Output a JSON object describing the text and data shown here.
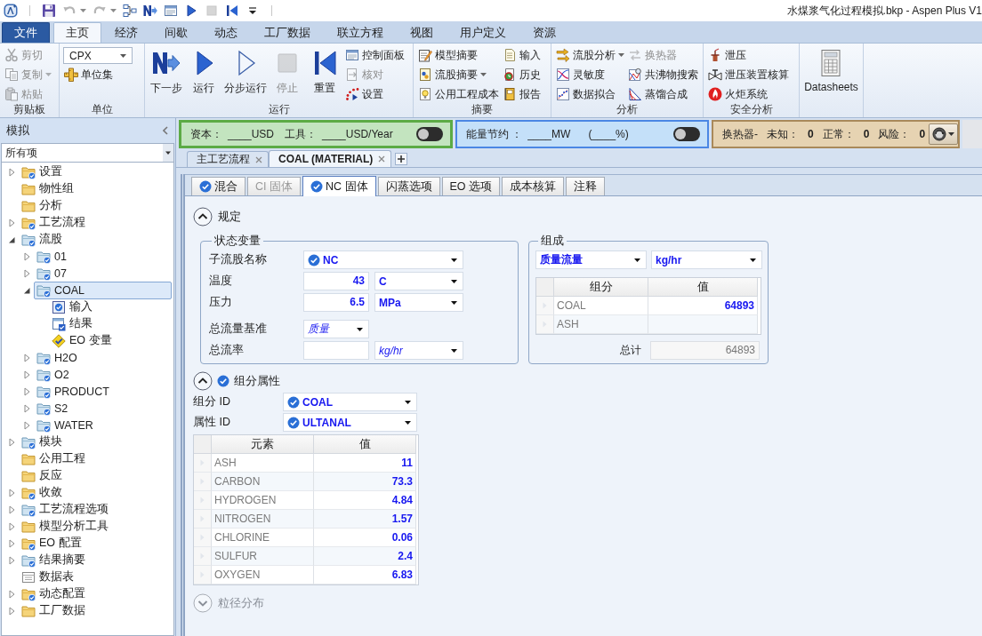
{
  "quick_access": {
    "buttons": [
      {
        "kind": "logo",
        "disabled": false
      },
      {
        "kind": "save",
        "disabled": false
      },
      {
        "kind": "undo",
        "disabled": true,
        "menu": true
      },
      {
        "kind": "redo",
        "disabled": true,
        "menu": true
      },
      {
        "kind": "flowsheet",
        "disabled": false
      },
      {
        "kind": "next",
        "disabled": false
      },
      {
        "kind": "panel",
        "disabled": false
      },
      {
        "kind": "run",
        "disabled": false
      },
      {
        "kind": "stop",
        "disabled": true
      },
      {
        "kind": "reset",
        "disabled": false
      },
      {
        "kind": "customize",
        "disabled": false
      }
    ],
    "title": "水煤浆气化过程模拟.bkp - Aspen Plus V1"
  },
  "ribbon": {
    "tabs": [
      {
        "label": "文件",
        "kind": "file",
        "selected": false
      },
      {
        "label": "主页",
        "kind": "tab",
        "selected": true
      },
      {
        "label": "经济",
        "kind": "tab",
        "selected": false
      },
      {
        "label": "间歇",
        "kind": "tab",
        "selected": false
      },
      {
        "label": "动态",
        "kind": "tab",
        "selected": false
      },
      {
        "label": "工厂数据",
        "kind": "tab",
        "selected": false
      },
      {
        "label": "联立方程",
        "kind": "tab",
        "selected": false
      },
      {
        "label": "视图",
        "kind": "tab",
        "selected": false
      },
      {
        "label": "用户定义",
        "kind": "tab",
        "selected": false
      },
      {
        "label": "资源",
        "kind": "tab",
        "selected": false
      }
    ],
    "groups": [
      {
        "label": "剪贴板",
        "items": [
          {
            "label": "剪切",
            "kind": "small",
            "disabled": true
          },
          {
            "label": "复制",
            "kind": "small",
            "disabled": true,
            "menu": true
          },
          {
            "label": "粘贴",
            "kind": "small",
            "disabled": true
          }
        ]
      },
      {
        "label": "单位",
        "items": [
          {
            "kind": "combo",
            "value": "CPX"
          },
          {
            "label": "单位集",
            "kind": "small",
            "disabled": false
          }
        ]
      },
      {
        "label": "运行",
        "items": [
          {
            "label": "下一步",
            "kind": "large",
            "disabled": false
          },
          {
            "label": "运行",
            "kind": "large",
            "disabled": false
          },
          {
            "label": "分步运行",
            "kind": "large",
            "disabled": false
          },
          {
            "label": "停止",
            "kind": "large",
            "disabled": true
          },
          {
            "label": "重置",
            "kind": "large",
            "disabled": false
          },
          {
            "label": "控制面板",
            "kind": "small",
            "disabled": false
          },
          {
            "label": "核对",
            "kind": "small",
            "disabled": true
          },
          {
            "label": "设置",
            "kind": "small",
            "disabled": false
          }
        ]
      },
      {
        "label": "摘要",
        "items": [
          {
            "label": "模型摘要",
            "kind": "small",
            "disabled": false
          },
          {
            "label": "流股摘要",
            "kind": "small",
            "disabled": false,
            "menu": true
          },
          {
            "label": "公用工程成本",
            "kind": "small",
            "disabled": false
          },
          {
            "label": "输入",
            "kind": "small",
            "disabled": false
          },
          {
            "label": "历史",
            "kind": "small",
            "disabled": false
          },
          {
            "label": "报告",
            "kind": "small",
            "disabled": false
          }
        ]
      },
      {
        "label": "分析",
        "items": [
          {
            "label": "流股分析",
            "kind": "small",
            "disabled": false,
            "menu": true
          },
          {
            "label": "灵敏度",
            "kind": "small",
            "disabled": false
          },
          {
            "label": "数据拟合",
            "kind": "small",
            "disabled": false
          },
          {
            "label": "换热器",
            "kind": "small",
            "disabled": true
          },
          {
            "label": "共沸物搜索",
            "kind": "small",
            "disabled": false
          },
          {
            "label": "蒸馏合成",
            "kind": "small",
            "disabled": false
          }
        ]
      },
      {
        "label": "安全分析",
        "items": [
          {
            "label": "泄压",
            "kind": "small",
            "disabled": false
          },
          {
            "label": "泄压装置核算",
            "kind": "small",
            "disabled": false
          },
          {
            "label": "火炬系统",
            "kind": "small",
            "disabled": false
          }
        ]
      },
      {
        "items": [
          {
            "label": "Datasheets",
            "kind": "large",
            "disabled": false
          }
        ]
      }
    ]
  },
  "economics_bar": {
    "items": [
      {
        "label": "资本：",
        "value": "____USD"
      },
      {
        "label": "工具：",
        "value": "____USD/Year"
      }
    ],
    "on": false
  },
  "energy_bar": {
    "label": "能量节约 ：",
    "value": "____MW",
    "percent": "(____%)",
    "on": false
  },
  "exchanger_bar": {
    "label": "换热器-",
    "items": [
      {
        "label": "未知：",
        "value": "0"
      },
      {
        "label": "正常：",
        "value": "0"
      },
      {
        "label": "风险：",
        "value": "0"
      }
    ]
  },
  "sidebar": {
    "title": "模拟",
    "filter": "所有项",
    "tree": [
      {
        "label": "设置",
        "kind": "folder",
        "checked": true,
        "selected": false,
        "expanded": false
      },
      {
        "label": "物性组",
        "kind": "folder",
        "checked": false,
        "selected": false
      },
      {
        "label": "分析",
        "kind": "folder",
        "checked": false,
        "selected": false
      },
      {
        "label": "工艺流程",
        "kind": "folder",
        "checked": true,
        "selected": false,
        "expanded": false
      },
      {
        "label": "流股",
        "kind": "stream-folder",
        "checked": true,
        "selected": false,
        "expanded": true,
        "children": [
          {
            "label": "01",
            "kind": "stream-folder",
            "checked": true,
            "selected": false,
            "expanded": false
          },
          {
            "label": "07",
            "kind": "stream-folder",
            "checked": true,
            "selected": false,
            "expanded": false
          },
          {
            "label": "COAL",
            "kind": "stream-folder",
            "checked": true,
            "selected": true,
            "expanded": true,
            "children": [
              {
                "label": "输入",
                "kind": "form",
                "checked": true,
                "selected": false
              },
              {
                "label": "结果",
                "kind": "results",
                "checked": true,
                "selected": false
              },
              {
                "label": "EO 变量",
                "kind": "eo",
                "checked": true,
                "selected": false
              }
            ]
          },
          {
            "label": "H2O",
            "kind": "stream-folder",
            "checked": true,
            "selected": false,
            "expanded": false
          },
          {
            "label": "O2",
            "kind": "stream-folder",
            "checked": true,
            "selected": false,
            "expanded": false
          },
          {
            "label": "PRODUCT",
            "kind": "stream-folder",
            "checked": true,
            "selected": false,
            "expanded": false
          },
          {
            "label": "S2",
            "kind": "stream-folder",
            "checked": true,
            "selected": false,
            "expanded": false
          },
          {
            "label": "WATER",
            "kind": "stream-folder",
            "checked": true,
            "selected": false,
            "expanded": false
          }
        ]
      },
      {
        "label": "模块",
        "kind": "stream-folder",
        "checked": true,
        "selected": false,
        "expanded": false
      },
      {
        "label": "公用工程",
        "kind": "folder",
        "checked": false,
        "selected": false
      },
      {
        "label": "反应",
        "kind": "folder",
        "checked": false,
        "selected": false
      },
      {
        "label": "收敛",
        "kind": "folder",
        "checked": true,
        "selected": false,
        "expanded": false
      },
      {
        "label": "工艺流程选项",
        "kind": "stream-folder",
        "checked": true,
        "selected": false,
        "expanded": false
      },
      {
        "label": "模型分析工具",
        "kind": "folder",
        "checked": false,
        "selected": false,
        "expanded": false
      },
      {
        "label": "EO 配置",
        "kind": "folder",
        "checked": true,
        "selected": false,
        "expanded": false
      },
      {
        "label": "结果摘要",
        "kind": "stream-folder",
        "checked": true,
        "selected": false,
        "expanded": false
      },
      {
        "label": "数据表",
        "kind": "table",
        "checked": false,
        "selected": false
      },
      {
        "label": "动态配置",
        "kind": "folder",
        "checked": true,
        "selected": false,
        "expanded": false
      },
      {
        "label": "工厂数据",
        "kind": "folder",
        "checked": false,
        "selected": false,
        "expanded": false
      }
    ]
  },
  "doc_tabs": [
    {
      "label": "主工艺流程",
      "selected": false
    },
    {
      "label": "COAL (MATERIAL)",
      "selected": true
    }
  ],
  "form_tabs": [
    {
      "label": "混合",
      "checked": true,
      "disabled": false,
      "selected": false
    },
    {
      "label": "CI 固体",
      "checked": false,
      "disabled": true,
      "selected": false
    },
    {
      "label": "NC 固体",
      "checked": true,
      "disabled": false,
      "selected": true
    },
    {
      "label": "闪蒸选项",
      "checked": false,
      "disabled": false,
      "selected": false
    },
    {
      "label": "EO 选项",
      "checked": false,
      "disabled": false,
      "selected": false
    },
    {
      "label": "成本核算",
      "checked": false,
      "disabled": false,
      "selected": false
    },
    {
      "label": "注释",
      "checked": false,
      "disabled": false,
      "selected": false
    }
  ],
  "specification": {
    "title": "规定",
    "expanded": true,
    "state_variables": {
      "title": "状态变量",
      "rows": [
        {
          "label": "子流股名称",
          "kind": "select",
          "value": {
            "text": "NC",
            "checked": true,
            "default": false
          }
        },
        {
          "label": "温度",
          "kind": "quantity",
          "value": {
            "text": "43",
            "default": false
          },
          "unit": {
            "text": "C",
            "default": false
          }
        },
        {
          "label": "压力",
          "kind": "quantity",
          "value": {
            "text": "6.5",
            "default": false
          },
          "unit": {
            "text": "MPa",
            "default": false
          }
        },
        {
          "label": "总流量基准",
          "kind": "basis",
          "value": {
            "text": "质量",
            "default": true
          }
        },
        {
          "label": "总流率",
          "kind": "quantity",
          "unit": {
            "text": "kg/hr",
            "default": true
          }
        }
      ]
    },
    "composition": {
      "title": "组成",
      "basis": {
        "text": "质量流量",
        "default": false
      },
      "unit": {
        "text": "kg/hr",
        "default": false
      },
      "columns": [
        "组分",
        "值"
      ],
      "rows": [
        {
          "component": "COAL",
          "value": "64893"
        },
        {
          "component": "ASH"
        }
      ],
      "total_label": "总计",
      "total": "64893"
    }
  },
  "component_attributes": {
    "title": "组分属性",
    "expanded": true,
    "checked": true,
    "fields": [
      {
        "label": "组分 ID",
        "value": {
          "text": "COAL",
          "checked": true,
          "default": false
        }
      },
      {
        "label": "属性 ID",
        "value": {
          "text": "ULTANAL",
          "checked": true,
          "default": false
        }
      }
    ],
    "table": {
      "columns": [
        "元素",
        "值"
      ],
      "rows": [
        {
          "element": "ASH",
          "value": "11"
        },
        {
          "element": "CARBON",
          "value": "73.3"
        },
        {
          "element": "HYDROGEN",
          "value": "4.84"
        },
        {
          "element": "NITROGEN",
          "value": "1.57"
        },
        {
          "element": "CHLORINE",
          "value": "0.06"
        },
        {
          "element": "SULFUR",
          "value": "2.4"
        },
        {
          "element": "OXYGEN",
          "value": "6.83"
        }
      ]
    }
  },
  "particle_size": {
    "title": "粒径分布",
    "expanded": false,
    "disabled": true
  }
}
